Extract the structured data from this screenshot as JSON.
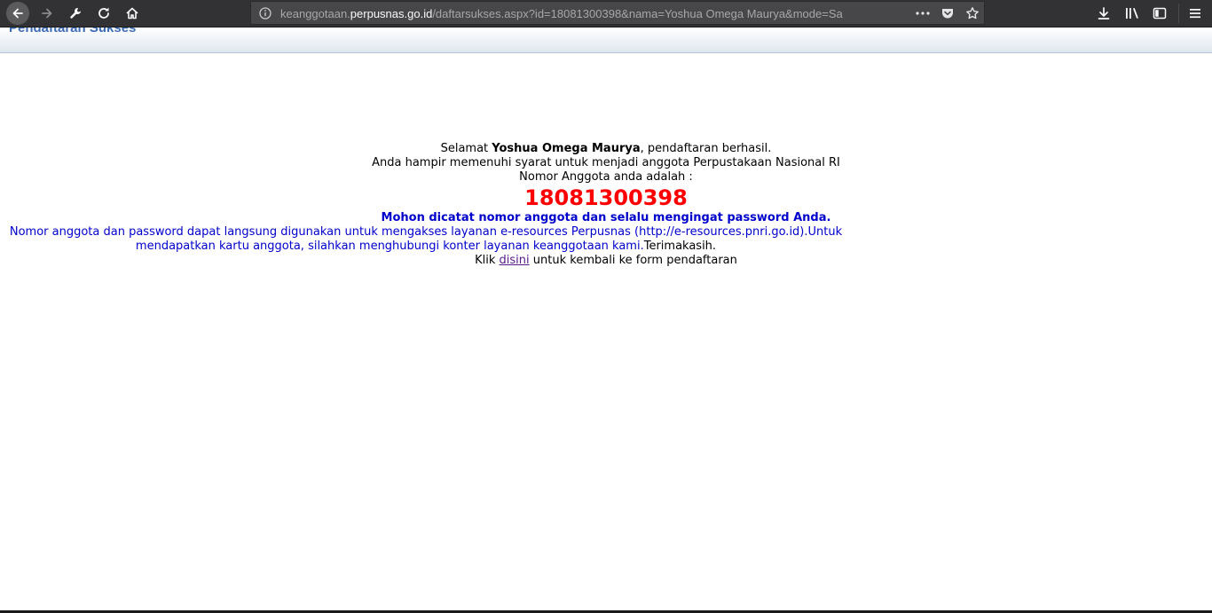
{
  "browser": {
    "url_prefix": "keanggotaan.",
    "url_host": "perpusnas.go.id",
    "url_rest": "/daftarsukses.aspx?id=18081300398&nama=Yoshua Omega Maurya&mode=Sa",
    "icons": {
      "back": "back-arrow-icon",
      "forward": "forward-arrow-icon",
      "customize": "wrench-icon",
      "reload": "reload-icon",
      "home": "home-icon",
      "info": "info-icon",
      "page_actions": "more-dots-icon",
      "pocket": "pocket-icon",
      "bookmark": "star-icon",
      "downloads": "download-icon",
      "library": "library-icon",
      "sidebar": "sidebar-icon",
      "menu": "hamburger-menu-icon"
    }
  },
  "page": {
    "header_title": "Pendaftaran Sukses",
    "greeting_prefix": "Selamat ",
    "member_name": "Yoshua Omega Maurya",
    "greeting_suffix": ", pendaftaran berhasil.",
    "eligibility_text": "Anda hampir memenuhi syarat untuk menjadi anggota Perpustakaan Nasional RI",
    "member_number_label": "Nomor Anggota anda adalah :",
    "member_number": "18081300398",
    "notice": "Mohon dicatat nomor anggota dan selalu mengingat password Anda.",
    "info_text": "Nomor anggota dan password dapat langsung digunakan untuk mengakses layanan e-resources Perpusnas (http://e-resources.pnri.go.id).Untuk mendapatkan kartu anggota, silahkan menghubungi konter layanan keanggotaan kami.",
    "thanks": "Terimakasih.",
    "back_prefix": "Klik ",
    "back_link": "disini",
    "back_suffix": " untuk kembali ke form pendaftaran"
  },
  "colors": {
    "member_number": "#ff0000",
    "notice": "#0000cc",
    "header_title": "#3f6db5",
    "link": "#551a8b",
    "toolbar": "#323234"
  }
}
